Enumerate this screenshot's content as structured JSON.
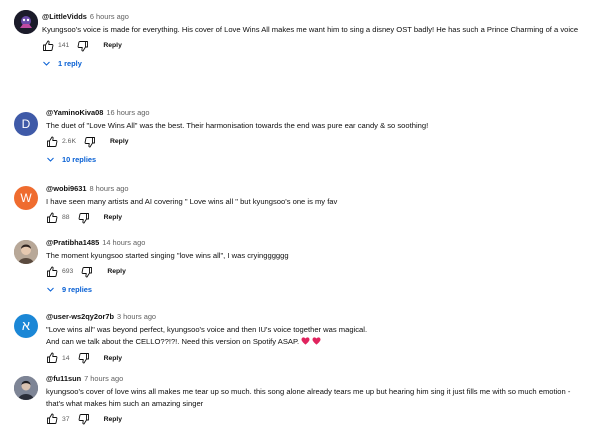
{
  "comments": [
    {
      "author": "@LittleVidds",
      "time": "6 hours ago",
      "text": "Kyungsoo's voice is made for everything. His cover of Love Wins All makes me want him to sing a disney OST badly! He has such a Prince Charming of a voice",
      "likes": "141",
      "reply_label": "Reply",
      "replies_label": "1 reply",
      "avatar_color": "#1b1b2a"
    },
    {
      "author": "@YaminoKiva08",
      "time": "16 hours ago",
      "text": "The duet of \"Love Wins All\" was the best. Their harmonisation towards the end was pure ear candy & so soothing!",
      "likes": "2.6K",
      "reply_label": "Reply",
      "replies_label": "10 replies",
      "avatar_letter": "D",
      "avatar_color": "#3f5aa8"
    },
    {
      "author": "@wobi9631",
      "time": "8 hours ago",
      "text": "I have seen many artists and AI covering \" Love wins all \" but kyungsoo's one is my fav",
      "likes": "88",
      "reply_label": "Reply",
      "avatar_letter": "W",
      "avatar_color": "#ef6c2f"
    },
    {
      "author": "@Pratibha1485",
      "time": "14 hours ago",
      "text": "The moment kyungsoo started singing \"love wins all\", I was cryingggggg",
      "likes": "693",
      "reply_label": "Reply",
      "replies_label": "9 replies",
      "avatar_color": "#8a7a6a"
    },
    {
      "author": "@user-ws2qy2or7b",
      "time": "3 hours ago",
      "text_lines": [
        "\"Love wins all\" was beyond perfect, kyungsoo's voice and then IU's voice together was magical.",
        "And can we talk about the CELLO??!?!. Need this version on Spotify ASAP."
      ],
      "likes": "14",
      "reply_label": "Reply",
      "avatar_letter": "א",
      "avatar_color": "#1b87d6"
    },
    {
      "author": "@fu11sun",
      "time": "7 hours ago",
      "text": "kyungsoo's cover of love wins all makes me tear up so much. this song alone already tears me up but hearing him sing it just fills me with so much emotion - that's what makes him such an amazing singer",
      "likes": "37",
      "reply_label": "Reply",
      "avatar_color": "#4a4e5c"
    }
  ],
  "icons": {
    "like": "thumbs-up-icon",
    "dislike": "thumbs-down-icon",
    "expand": "chevron-down-icon",
    "heart": "red-heart-emoji"
  },
  "colors": {
    "link": "#065fd4",
    "heart": "#e0245e"
  }
}
